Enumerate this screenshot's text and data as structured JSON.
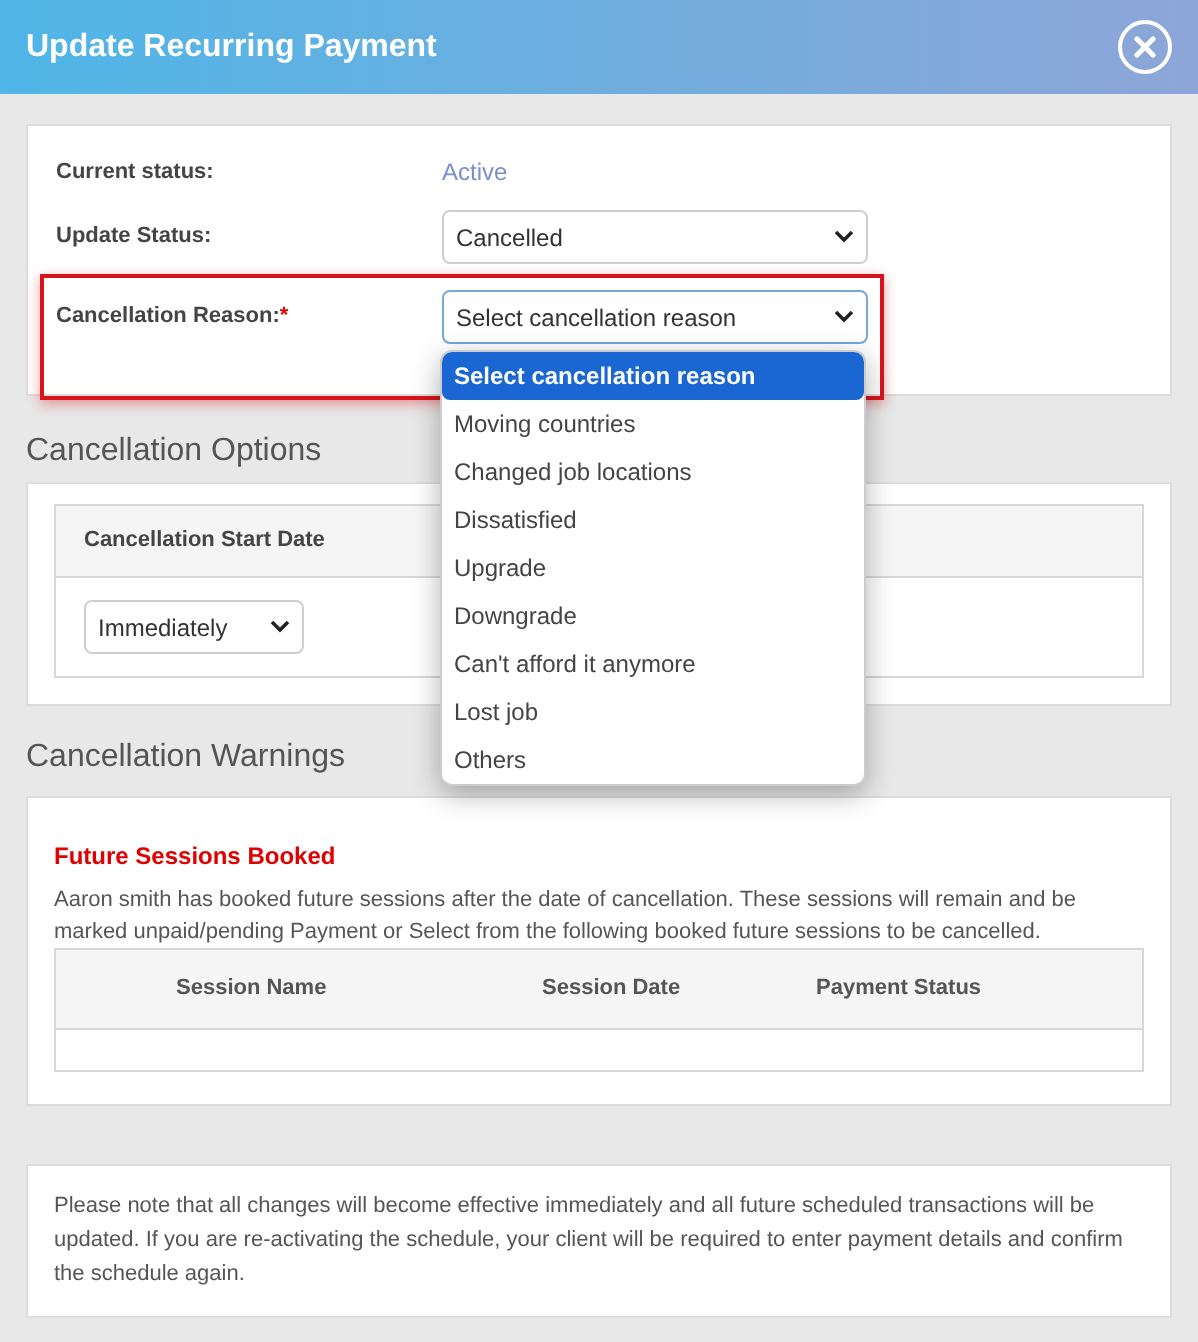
{
  "dialog": {
    "title": "Update Recurring Payment"
  },
  "status": {
    "current_label": "Current status:",
    "current_value": "Active",
    "update_label": "Update Status:",
    "update_value": "Cancelled"
  },
  "reason": {
    "label": "Cancellation Reason:",
    "required_mark": "*",
    "value": "Select cancellation reason",
    "highlighted": true,
    "expanded": true,
    "options": [
      {
        "label": "Select cancellation reason",
        "selected": true
      },
      {
        "label": "Moving countries",
        "selected": false
      },
      {
        "label": "Changed job locations",
        "selected": false
      },
      {
        "label": "Dissatisfied",
        "selected": false
      },
      {
        "label": "Upgrade",
        "selected": false
      },
      {
        "label": "Downgrade",
        "selected": false
      },
      {
        "label": "Can't afford it anymore",
        "selected": false
      },
      {
        "label": "Lost job",
        "selected": false
      },
      {
        "label": "Others",
        "selected": false
      }
    ]
  },
  "options_section": {
    "title": "Cancellation Options",
    "column": "Cancellation Start Date",
    "start_value": "Immediately"
  },
  "warnings_section": {
    "title": "Cancellation Warnings",
    "heading": "Future Sessions Booked",
    "message": "Aaron smith has booked future sessions after the date of cancellation. These sessions will remain and be marked unpaid/pending Payment or Select from the following booked future sessions to be cancelled.",
    "columns": [
      "Session Name",
      "Session Date",
      "Payment Status"
    ]
  },
  "note": "Please note that all changes will become effective immediately and all future scheduled transactions will be updated. If you are re-activating the schedule, your client will be required to enter payment details and confirm the schedule again."
}
